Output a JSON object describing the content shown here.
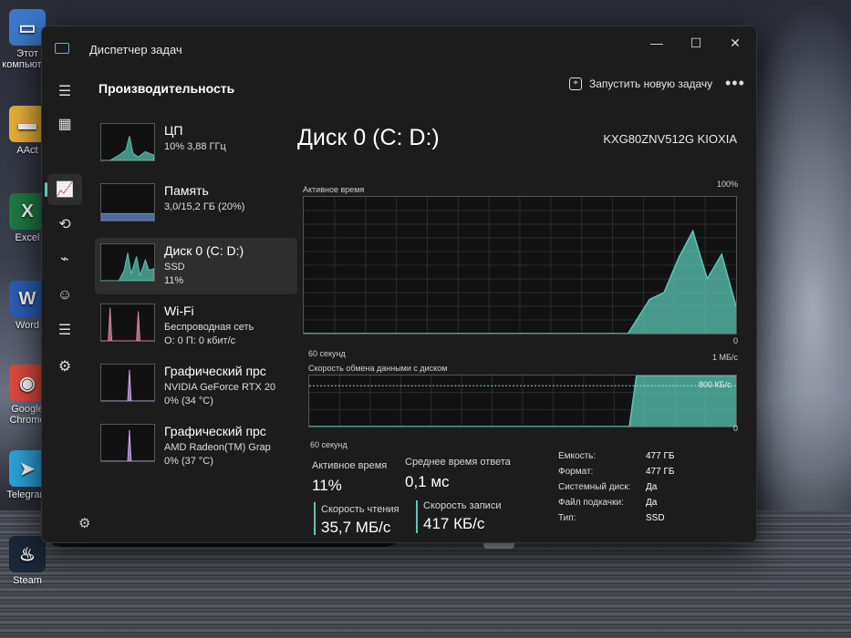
{
  "desktop": {
    "icons": [
      {
        "label": "Этот\nкомпьютер",
        "glyph": "▭",
        "color": "#3b79c9"
      },
      {
        "label": "AAct",
        "glyph": "▬",
        "color": "#e8b13b"
      },
      {
        "label": "Excel",
        "glyph": "X",
        "color": "#1f7a44"
      },
      {
        "label": "Word",
        "glyph": "W",
        "color": "#2b5eb5"
      },
      {
        "label": "Google\nChrome",
        "glyph": "◉",
        "color": "#dd4b3e"
      },
      {
        "label": "Telegram",
        "glyph": "➤",
        "color": "#2ea3dd"
      },
      {
        "label": "Steam",
        "glyph": "♨",
        "color": "#1b2838"
      }
    ]
  },
  "window": {
    "title": "Диспетчер задач",
    "controls": {
      "minimize": "—",
      "maximize": "☐",
      "close": "✕"
    },
    "header": "Производительность",
    "run_task": "Запустить новую задачу",
    "more": "•••"
  },
  "nav": [
    {
      "icon": "hamburger-icon",
      "glyph": "☰",
      "active": false
    },
    {
      "icon": "processes-icon",
      "glyph": "▦",
      "active": false
    },
    {
      "icon": "performance-icon",
      "glyph": "📈",
      "active": true
    },
    {
      "icon": "app-history-icon",
      "glyph": "⟲",
      "active": false
    },
    {
      "icon": "startup-icon",
      "glyph": "⌁",
      "active": false
    },
    {
      "icon": "users-icon",
      "glyph": "☺",
      "active": false
    },
    {
      "icon": "details-icon",
      "glyph": "☰",
      "active": false
    },
    {
      "icon": "services-icon",
      "glyph": "⚙",
      "active": false
    }
  ],
  "resources": [
    {
      "name": "ЦП",
      "sub": "10% 3,88 ГГц",
      "sub2": "",
      "color": "#5ac8b4",
      "selected": false
    },
    {
      "name": "Память",
      "sub": "3,0/15,2 ГБ (20%)",
      "sub2": "",
      "color": "#6c8fd9",
      "selected": false
    },
    {
      "name": "Диск 0 (C: D:)",
      "sub": "SSD",
      "sub2": "11%",
      "color": "#5ac8b4",
      "selected": true
    },
    {
      "name": "Wi-Fi",
      "sub": "Беспроводная сеть",
      "sub2": "О: 0 П: 0 кбит/с",
      "color": "#d98ba8",
      "selected": false
    },
    {
      "name": "Графический прс",
      "sub": "NVIDIA GeForce RTX 20",
      "sub2": "0% (34 °C)",
      "color": "#c9a7e8",
      "selected": false
    },
    {
      "name": "Графический прс",
      "sub": "AMD Radeon(TM) Grap",
      "sub2": "0% (37 °C)",
      "color": "#c9a7e8",
      "selected": false
    }
  ],
  "detail": {
    "title": "Диск 0 (C: D:)",
    "model": "KXG80ZNV512G KIOXIA",
    "active_time_label": "Активное время",
    "active_time_max": "100%",
    "active_time_min": "0",
    "active_time_xlabel": "60 секунд",
    "transfer_label": "Скорость обмена данными с диском",
    "transfer_max": "1 МБ/с",
    "transfer_mark": "800 КБ/с",
    "transfer_min": "0",
    "transfer_xlabel": "60 секунд",
    "accent": "#5ac8b4"
  },
  "stats": {
    "active_time_label": "Активное время",
    "active_time_value": "11%",
    "avg_response_label": "Среднее время ответа",
    "avg_response_value": "0,1 мс",
    "read_label": "Скорость чтения",
    "read_value": "35,7 МБ/с",
    "write_label": "Скорость записи",
    "write_value": "417 КБ/с"
  },
  "properties": [
    {
      "label": "Емкость:",
      "value": "477 ГБ"
    },
    {
      "label": "Формат:",
      "value": "477 ГБ"
    },
    {
      "label": "Системный диск:",
      "value": "Да"
    },
    {
      "label": "Файл подкачки:",
      "value": "Да"
    },
    {
      "label": "Тип:",
      "value": "SSD"
    }
  ],
  "chart_data": [
    {
      "type": "area",
      "title": "Активное время",
      "ylabel": "%",
      "ylim": [
        0,
        100
      ],
      "x": [
        0,
        5,
        10,
        15,
        20,
        25,
        30,
        35,
        40,
        45,
        48,
        50,
        52,
        54,
        56,
        58,
        60
      ],
      "values": [
        0,
        0,
        0,
        0,
        0,
        0,
        0,
        0,
        0,
        0,
        25,
        30,
        55,
        75,
        40,
        58,
        20
      ],
      "xlabel": "60 секунд"
    },
    {
      "type": "area",
      "title": "Скорость обмена данными с диском",
      "ylabel": "МБ/с",
      "ylim": [
        0,
        1
      ],
      "x": [
        0,
        45,
        46,
        48,
        50,
        52,
        54,
        56,
        58,
        60
      ],
      "values": [
        0,
        0,
        1,
        1,
        1,
        1,
        1,
        1,
        1,
        1
      ],
      "xlabel": "60 секунд"
    }
  ]
}
